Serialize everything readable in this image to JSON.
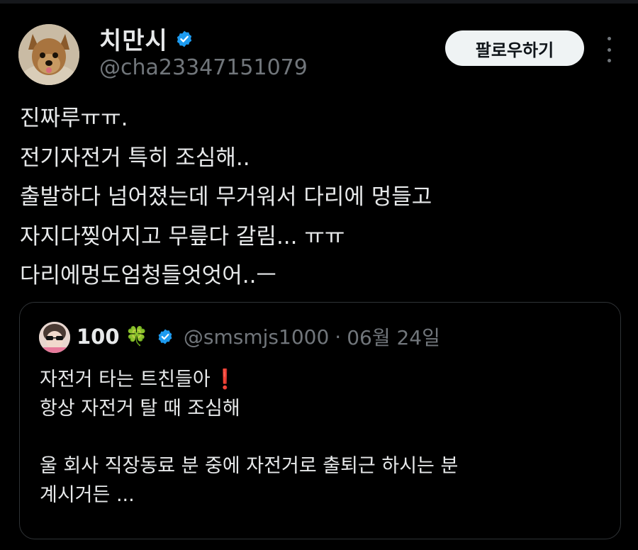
{
  "author": {
    "display_name": "치만시",
    "handle": "@cha23347151079",
    "verified_icon": "verified-badge-icon",
    "avatar": "yorkshire-terrier-avatar"
  },
  "actions": {
    "follow_label": "팔로우하기",
    "more_icon": "more-dots-icon"
  },
  "tweet": {
    "lines": [
      "진짜루ㅠㅠ.",
      "전기자전거 특히 조심해..",
      "출발하다 넘어졌는데 무거워서 다리에 멍들고",
      "자지다찢어지고 무릎다 갈림... ㅠㅠ",
      "다리에멍도엄청들엇엇어..ㅡ"
    ]
  },
  "quote": {
    "display_name": "100",
    "name_emoji": "🍀",
    "handle": "@smsmjs1000",
    "separator": "·",
    "date": "06월 24일",
    "line1": "자전거 타는 트친들아",
    "line1_emoji": "❗",
    "line2": "항상 자전거 탈 때 조심해",
    "line3": "울 회사 직장동료 분 중에 자전거로 출퇴근 하시는 분",
    "line4": "계시거든 ..."
  },
  "colors": {
    "background": "#000000",
    "text": "#e7e9ea",
    "secondary": "#71767b",
    "verified": "#1d9bf0",
    "border": "#2f3336"
  }
}
